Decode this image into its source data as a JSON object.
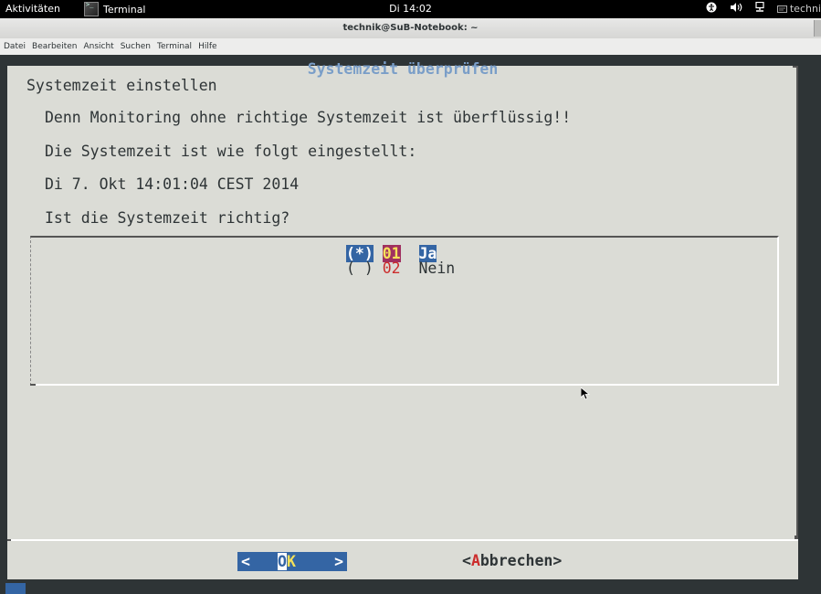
{
  "topbar": {
    "activities": "Aktivitäten",
    "app_name": "Terminal",
    "clock": "Di 14:02",
    "user": "techni"
  },
  "window": {
    "title": "technik@SuB-Notebook: ~"
  },
  "menubar": {
    "items": [
      "Datei",
      "Bearbeiten",
      "Ansicht",
      "Suchen",
      "Terminal",
      "Hilfe"
    ]
  },
  "dialog": {
    "title": "Systemzeit überprüfen",
    "heading": "Systemzeit einstellen",
    "message1": "Denn Monitoring ohne richtige Systemzeit ist überflüssig!!",
    "message2": "Die Systemzeit ist wie folgt eingestellt:",
    "message3": "Di 7. Okt 14:01:04 CEST 2014",
    "message4": "Ist die Systemzeit richtig?",
    "options": [
      {
        "marker": "(*)",
        "tag": "01",
        "label": "Ja",
        "selected": true
      },
      {
        "marker": "( )",
        "tag": "02",
        "label": "Nein",
        "selected": false
      }
    ],
    "ok_left": "<",
    "ok_o": "O",
    "ok_k": "K",
    "ok_right": ">",
    "cancel_lt": "<",
    "cancel_a": "A",
    "cancel_rest": "bbrechen>"
  },
  "colors": {
    "dialog_bg": "#dbdcd6",
    "title": "#7a9ec8",
    "selection": "#3465a4",
    "hotkey": "#cc2d2d"
  },
  "icons": [
    "terminal-app-icon",
    "accessibility-icon",
    "volume-icon",
    "network-icon",
    "user-icon",
    "mouse-pointer-icon"
  ]
}
